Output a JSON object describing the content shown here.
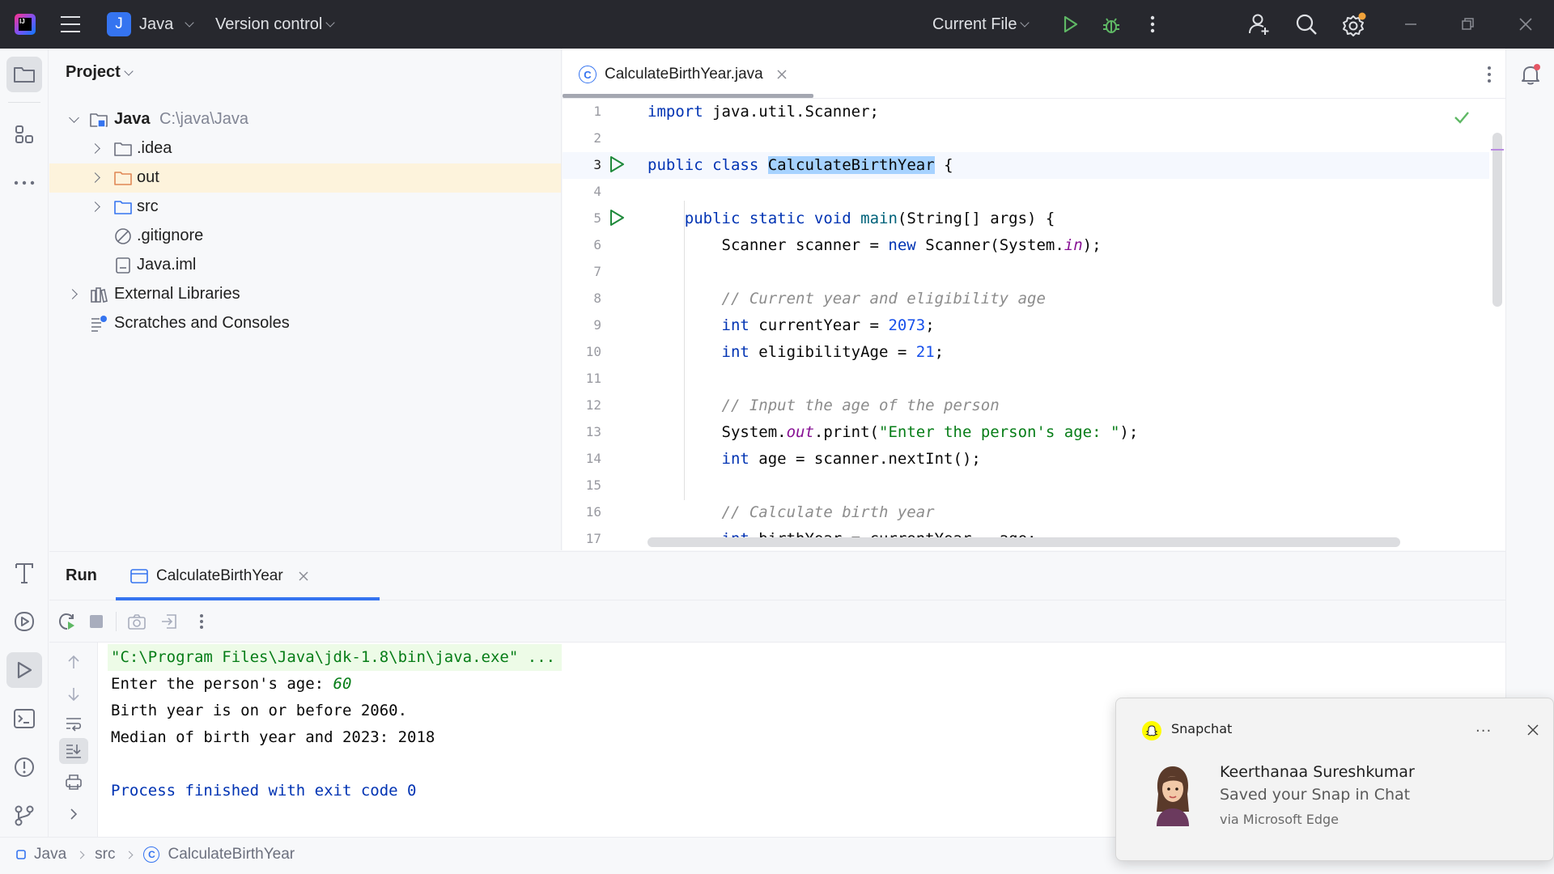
{
  "titlebar": {
    "project_badge": "J",
    "project_name": "Java",
    "vcs_label": "Version control",
    "run_config": "Current File"
  },
  "project_panel": {
    "header": "Project",
    "tree": [
      {
        "label": "Java",
        "path": "C:\\java\\Java"
      },
      {
        "label": ".idea"
      },
      {
        "label": "out"
      },
      {
        "label": "src"
      },
      {
        "label": ".gitignore"
      },
      {
        "label": "Java.iml"
      },
      {
        "label": "External Libraries"
      },
      {
        "label": "Scratches and Consoles"
      }
    ]
  },
  "editor": {
    "tab_label": "CalculateBirthYear.java",
    "tab_icon": "C",
    "line_numbers": [
      "1",
      "2",
      "3",
      "4",
      "5",
      "6",
      "7",
      "8",
      "9",
      "10",
      "11",
      "12",
      "13",
      "14",
      "15",
      "16",
      "17"
    ]
  },
  "run_panel": {
    "title": "Run",
    "tab_label": "CalculateBirthYear",
    "console": {
      "cmd": "\"C:\\Program Files\\Java\\jdk-1.8\\bin\\java.exe\" ...",
      "prompt": "Enter the person's age: ",
      "input": "60",
      "line3": "Birth year is on or before 2060.",
      "line4": "Median of birth year and 2023: 2018",
      "exit": "Process finished with exit code 0"
    }
  },
  "status_bar": {
    "breadcrumb": [
      "Java",
      "src",
      "CalculateBirthYear"
    ]
  },
  "notification": {
    "app_name": "Snapchat",
    "more": "···",
    "title": "Keerthanaa Sureshkumar",
    "body": "Saved your Snap in Chat",
    "attribution": "via Microsoft Edge"
  },
  "colors": {
    "accent": "#3574f0",
    "titlebar_bg": "#27282e",
    "run_green": "#208a3c",
    "keyword": "#0033b3",
    "string": "#067d17",
    "selected_row": "#fdf3dc"
  },
  "icons": [
    "app-logo-icon",
    "hamburger-icon",
    "run-icon",
    "debug-icon",
    "more-icon",
    "add-user-icon",
    "search-icon",
    "settings-icon",
    "minimize-icon",
    "maximize-icon",
    "close-icon",
    "folder-icon",
    "structure-icon",
    "build-icon",
    "services-icon",
    "run-tool-icon",
    "terminal-icon",
    "problems-icon",
    "git-icon",
    "bell-icon",
    "check-icon",
    "rerun-icon",
    "stop-icon",
    "camera-icon",
    "exit-icon",
    "snapchat-icon"
  ]
}
